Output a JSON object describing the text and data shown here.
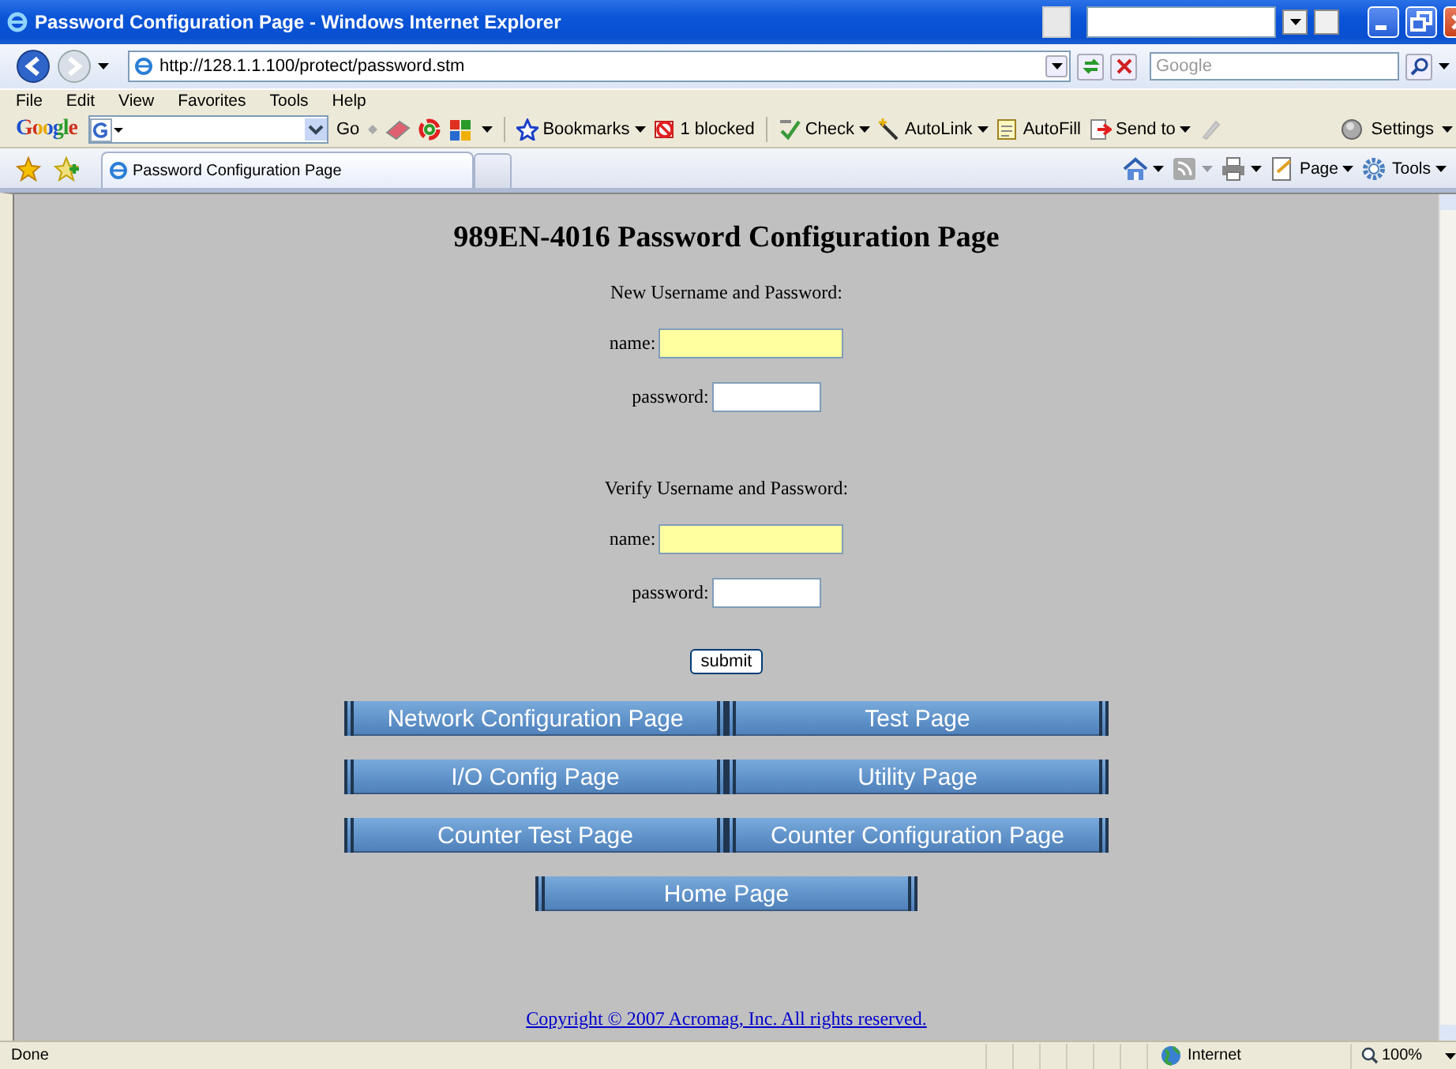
{
  "window": {
    "title": "Password Configuration Page - Windows Internet Explorer"
  },
  "address_bar": {
    "url": "http://128.1.1.100/protect/password.stm"
  },
  "search_box": {
    "placeholder": "Google"
  },
  "menu": [
    "File",
    "Edit",
    "View",
    "Favorites",
    "Tools",
    "Help"
  ],
  "google_toolbar": {
    "logo": "Google",
    "go": "Go",
    "items": [
      {
        "kind": "bookmarks",
        "label": "Bookmarks",
        "dropdown": true
      },
      {
        "kind": "blocked",
        "label": "1 blocked",
        "dropdown": false
      },
      {
        "kind": "check",
        "label": "Check",
        "dropdown": true
      },
      {
        "kind": "autolink",
        "label": "AutoLink",
        "dropdown": true
      },
      {
        "kind": "autofill",
        "label": "AutoFill",
        "dropdown": false
      },
      {
        "kind": "sendto",
        "label": "Send to",
        "dropdown": true
      }
    ],
    "settings": "Settings"
  },
  "tabs": [
    {
      "label": "Password Configuration Page",
      "selected": true
    }
  ],
  "command_bar": [
    {
      "kind": "home"
    },
    {
      "kind": "feeds"
    },
    {
      "kind": "print"
    },
    {
      "kind": "page",
      "label": "Page"
    },
    {
      "kind": "tools",
      "label": "Tools"
    }
  ],
  "page": {
    "heading": "989EN-4016 Password Configuration Page",
    "sections": [
      {
        "heading": "New Username and Password:",
        "fields": [
          {
            "label": "name:",
            "highlighted": true
          },
          {
            "label": "password:",
            "highlighted": false
          }
        ]
      },
      {
        "heading": "Verify Username and Password:",
        "fields": [
          {
            "label": "name:",
            "highlighted": true
          },
          {
            "label": "password:",
            "highlighted": false
          }
        ]
      }
    ],
    "submit": "submit",
    "nav_rows": [
      [
        "Network Configuration Page",
        "Test Page"
      ],
      [
        "I/O Config Page",
        "Utility Page"
      ],
      [
        "Counter Test Page",
        "Counter Configuration Page"
      ],
      [
        "Home Page"
      ]
    ],
    "footer_link": "Copyright © 2007 Acromag, Inc. All rights reserved."
  },
  "status_bar": {
    "text": "Done",
    "zone": "Internet",
    "zoom": "100%"
  }
}
